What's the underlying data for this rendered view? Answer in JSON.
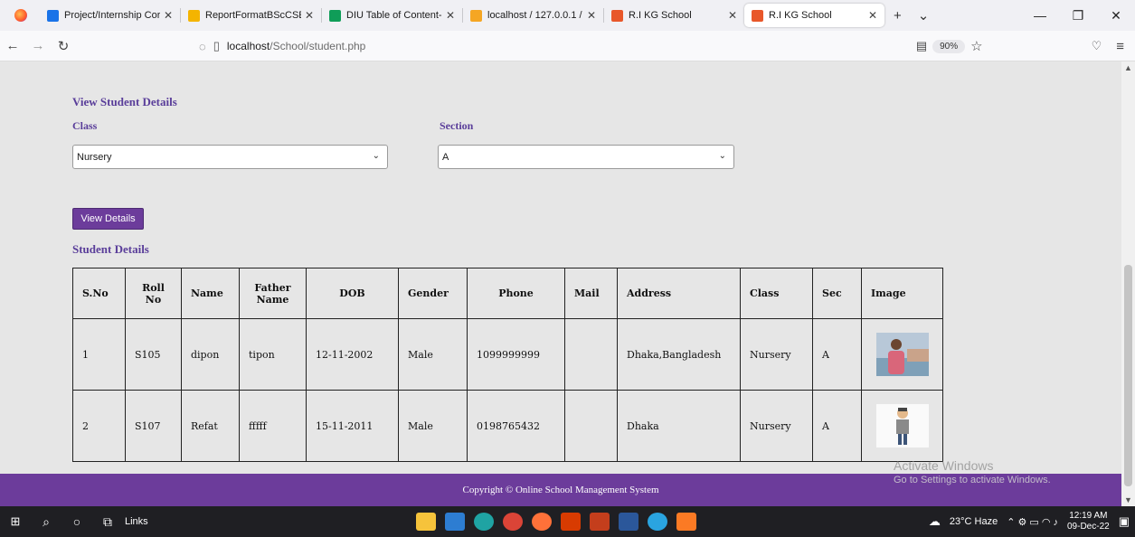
{
  "browser": {
    "tabs": [
      {
        "label": "Project/Internship Cor",
        "color": "#1a73e8",
        "active": false
      },
      {
        "label": "ReportFormatBScCSEU",
        "color": "#f4b400",
        "active": false
      },
      {
        "label": "DIU Table of Content- D",
        "color": "#0f9d58",
        "active": false
      },
      {
        "label": "localhost / 127.0.0.1 / s",
        "color": "#f5a623",
        "active": false
      },
      {
        "label": "R.I KG School",
        "color": "#e8572a",
        "active": false
      },
      {
        "label": "R.I KG School",
        "color": "#e8572a",
        "active": true
      }
    ],
    "url_host": "localhost",
    "url_path": "/School/student.php",
    "zoom": "90%"
  },
  "page": {
    "section_title": "View Student Details",
    "class_label": "Class",
    "class_value": "Nursery",
    "section_label": "Section",
    "section_value": "A",
    "view_button": "View Details",
    "table_title": "Student Details",
    "columns": [
      "S.No",
      "Roll No",
      "Name",
      "Father Name",
      "DOB",
      "Gender",
      "Phone",
      "Mail",
      "Address",
      "Class",
      "Sec",
      "Image"
    ],
    "rows": [
      {
        "sno": "1",
        "roll": "S105",
        "name": "dipon",
        "father": "tipon",
        "dob": "12-11-2002",
        "gender": "Male",
        "phone": "1099999999",
        "mail": "",
        "address": "Dhaka,Bangladesh",
        "class": "Nursery",
        "sec": "A",
        "image": "photo-of-person"
      },
      {
        "sno": "2",
        "roll": "S107",
        "name": "Refat",
        "father": "fffff",
        "dob": "15-11-2011",
        "gender": "Male",
        "phone": "0198765432",
        "mail": "",
        "address": "Dhaka",
        "class": "Nursery",
        "sec": "A",
        "image": "cartoon-avatar"
      }
    ],
    "footer": "Copyright © Online School Management System",
    "accent": "#6c3c9b"
  },
  "watermark": {
    "title": "Activate Windows",
    "subtitle": "Go to Settings to activate Windows."
  },
  "taskbar": {
    "links_label": "Links",
    "weather": "23°C Haze",
    "time": "12:19 AM",
    "date": "09-Dec-22"
  }
}
